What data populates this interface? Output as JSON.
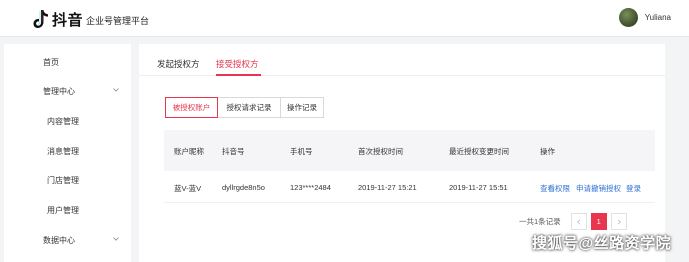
{
  "header": {
    "brand_name": "抖音",
    "brand_sub": "企业号管理平台",
    "username": "Yuliana"
  },
  "sidebar": {
    "items": [
      {
        "label": "首页"
      },
      {
        "label": "管理中心"
      },
      {
        "label": "内容管理"
      },
      {
        "label": "消息管理"
      },
      {
        "label": "门店管理"
      },
      {
        "label": "用户管理"
      },
      {
        "label": "数据中心"
      }
    ]
  },
  "tabs": [
    {
      "label": "发起授权方"
    },
    {
      "label": "接受授权方"
    }
  ],
  "segment": [
    {
      "label": "被授权账户"
    },
    {
      "label": "授权请求记录"
    },
    {
      "label": "操作记录"
    }
  ],
  "table": {
    "headers": [
      "账户昵称",
      "抖音号",
      "手机号",
      "首次授权时间",
      "最近授权变更时间",
      "操作"
    ],
    "rows": [
      {
        "nickname": "蓝V-蓝V",
        "douyin_id": "dyllrgde8n5o",
        "phone": "123****2484",
        "first_auth": "2019-11-27 15:21",
        "last_change": "2019-11-27 15:51",
        "actions": [
          "查看权限",
          "申请撤销授权",
          "登录"
        ]
      }
    ]
  },
  "pagination": {
    "total_text": "一共1条记录",
    "current_page": "1"
  },
  "watermark": "搜狐号@丝路资学院",
  "colors": {
    "accent": "#e8364f",
    "link": "#2d6fd6"
  }
}
